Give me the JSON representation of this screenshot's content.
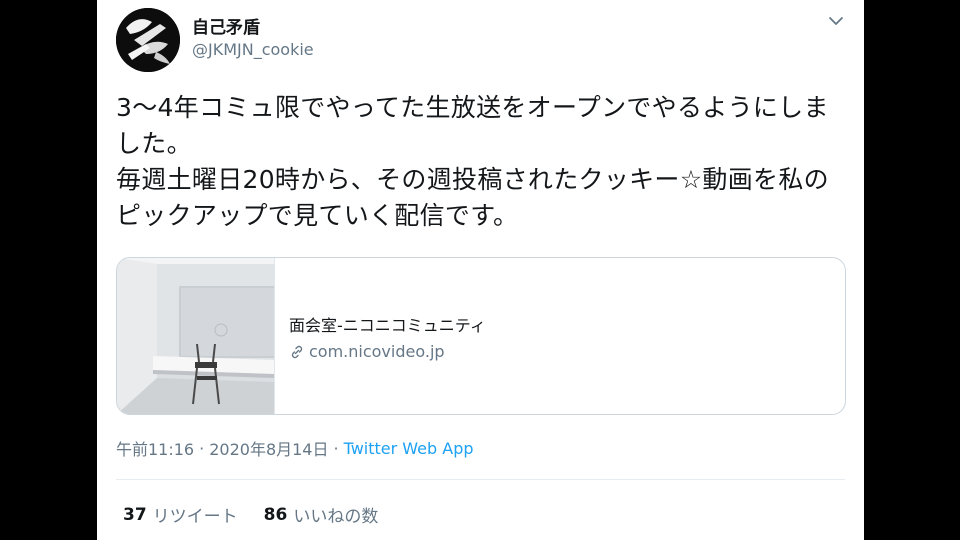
{
  "user": {
    "display_name": "自己矛盾",
    "handle": "@JKMJN_cookie",
    "avatar_icon": "avatar-image"
  },
  "menu_icon": "chevron-down-icon",
  "tweet": {
    "lines": [
      "3〜4年コミュ限でやってた生放送をオープンでやるようにしました。",
      "毎週土曜日20時から、その週投稿されたクッキー☆動画を私のピックアップで見ていく配信です。"
    ]
  },
  "link_card": {
    "title": "面会室-ニコニコミュニティ",
    "domain": "com.nicovideo.jp",
    "domain_icon": "link-icon"
  },
  "meta": {
    "time": "午前11:16",
    "separator": "·",
    "date": "2020年8月14日",
    "app": "Twitter Web App"
  },
  "stats": {
    "retweets_count": "37",
    "retweets_label": "リツイート",
    "likes_count": "86",
    "likes_label": "いいねの数"
  },
  "colors": {
    "background": "#000000",
    "card": "#ffffff",
    "text": "#14171a",
    "secondary": "#657786",
    "accent": "#1da1f2",
    "border": "#ccd6dd"
  }
}
